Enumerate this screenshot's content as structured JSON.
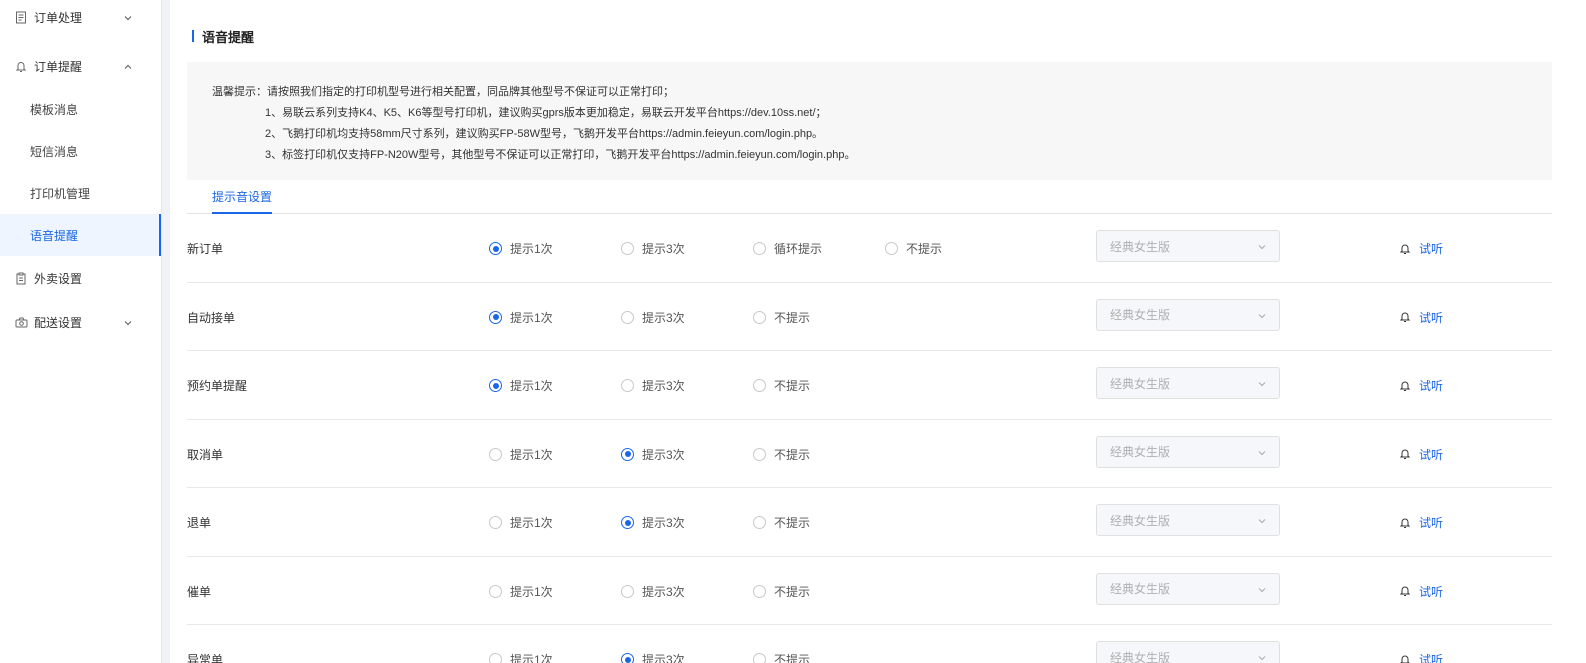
{
  "sidebar": {
    "groups": [
      {
        "label": "订单处理",
        "expanded": false
      },
      {
        "label": "订单提醒",
        "expanded": true
      },
      {
        "label": "外卖设置",
        "expanded": null
      },
      {
        "label": "配送设置",
        "expanded": false
      }
    ],
    "sub_items": [
      "模板消息",
      "短信消息",
      "打印机管理",
      "语音提醒"
    ],
    "active_sub": "语音提醒"
  },
  "main": {
    "title": "语音提醒",
    "tips": {
      "line1": "温馨提示：请按照我们指定的打印机型号进行相关配置，同品牌其他型号不保证可以正常打印；",
      "line2": "1、易联云系列支持K4、K5、K6等型号打印机，建议购买gprs版本更加稳定，易联云开发平台https://dev.10ss.net/；",
      "line3": "2、飞鹅打印机均支持58mm尺寸系列，建议购买FP-58W型号，飞鹅开发平台https://admin.feieyun.com/login.php。",
      "line4": "3、标签打印机仅支持FP-N20W型号，其他型号不保证可以正常打印，飞鹅开发平台https://admin.feieyun.com/login.php。"
    },
    "tab": "提示音设置",
    "options": {
      "once": "提示1次",
      "thrice": "提示3次",
      "loop": "循环提示",
      "none": "不提示"
    },
    "select_placeholder": "经典女生版",
    "listen_label": "试听",
    "rows": [
      {
        "label": "新订单",
        "selected": "once",
        "has_loop": true
      },
      {
        "label": "自动接单",
        "selected": "once",
        "has_loop": false
      },
      {
        "label": "预约单提醒",
        "selected": "once",
        "has_loop": false
      },
      {
        "label": "取消单",
        "selected": "thrice",
        "has_loop": false
      },
      {
        "label": "退单",
        "selected": "thrice",
        "has_loop": false
      },
      {
        "label": "催单",
        "selected": "none_selected",
        "has_loop": false
      },
      {
        "label": "异常单",
        "selected": "thrice",
        "has_loop": false
      }
    ]
  },
  "colors": {
    "accent": "#1a66e6",
    "active_bg": "#eef5fe",
    "tips_bg": "#f7f7f7"
  }
}
